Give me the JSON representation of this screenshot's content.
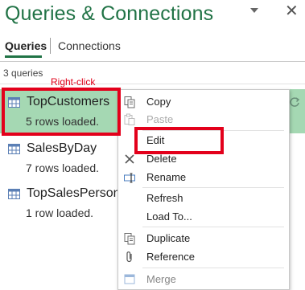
{
  "pane": {
    "title": "Queries & Connections",
    "close_glyph": "✕"
  },
  "tabs": [
    {
      "label": "Queries",
      "active": true
    },
    {
      "label": "Connections",
      "active": false
    }
  ],
  "query_count": "3 queries",
  "annotation": {
    "text": "Right-click",
    "color": "#e3001b"
  },
  "queries": [
    {
      "name": "TopCustomers",
      "status": "5 rows loaded.",
      "selected": true,
      "icon": "table-icon"
    },
    {
      "name": "SalesByDay",
      "status": "7 rows loaded.",
      "selected": false,
      "icon": "table-icon"
    },
    {
      "name": "TopSalesPerson",
      "status": "1 row loaded.",
      "selected": false,
      "icon": "table-icon"
    }
  ],
  "context_menu": {
    "items": [
      {
        "label": "Copy",
        "icon": "copy-icon",
        "enabled": true
      },
      {
        "label": "Paste",
        "icon": "paste-icon",
        "enabled": false
      },
      {
        "label": "Edit",
        "icon": "",
        "enabled": true,
        "highlighted_by_annotation": true
      },
      {
        "label": "Delete",
        "icon": "delete-icon",
        "enabled": true
      },
      {
        "label": "Rename",
        "icon": "rename-icon",
        "enabled": true
      },
      {
        "label": "Refresh",
        "icon": "",
        "enabled": true
      },
      {
        "label": "Load To...",
        "icon": "",
        "enabled": true
      },
      {
        "label": "Duplicate",
        "icon": "duplicate-icon",
        "enabled": true
      },
      {
        "label": "Reference",
        "icon": "reference-icon",
        "enabled": true
      },
      {
        "label": "Merge",
        "icon": "merge-icon",
        "enabled": true
      }
    ]
  },
  "colors": {
    "excel_green": "#217346",
    "selection": "#a5d8b3",
    "annotation_red": "#e3001b"
  }
}
